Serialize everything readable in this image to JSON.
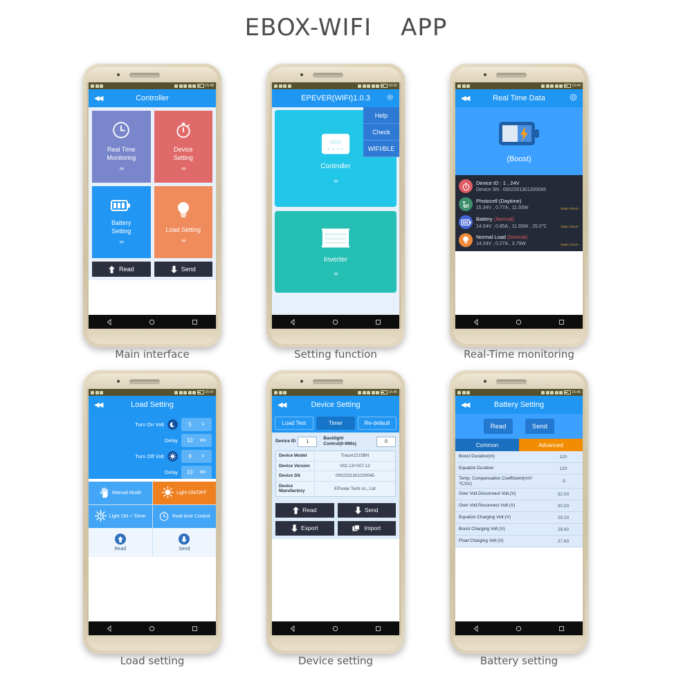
{
  "title": {
    "part1": "EBOX-WIFI",
    "part2": "APP"
  },
  "captions": [
    "Main interface",
    "Setting function",
    "Real-Time monitoring",
    "Load setting",
    "Device setting",
    "Battery setting"
  ],
  "phone1": {
    "status_time": "15:48",
    "header": "Controller",
    "back_icon": "◀◀",
    "tiles": [
      {
        "label1": "Real Time",
        "label2": "Monitoring",
        "chev": "»›",
        "color": "#7986cb",
        "icon": "clock-icon"
      },
      {
        "label1": "Device",
        "label2": "Setting",
        "chev": "»›",
        "color": "#e06a6a",
        "icon": "stopwatch-icon"
      },
      {
        "label1": "Battery",
        "label2": "Setting",
        "chev": "»›",
        "color": "#2196f3",
        "icon": "battery-icon"
      },
      {
        "label1": "Load Setting",
        "label2": "",
        "chev": "»›",
        "color": "#f08b5c",
        "icon": "bulb-icon"
      }
    ],
    "read_label": "Read",
    "send_label": "Send"
  },
  "phone2": {
    "status_time": "15:50",
    "header": "EPEVER(WIFI)1.0.3",
    "menu": [
      "Help",
      "Check",
      "WIFI/BLE"
    ],
    "tile1": {
      "label": "Controller",
      "chev": "»›",
      "color": "#22c6e8"
    },
    "tile2": {
      "label": "Inverter",
      "chev": "»›",
      "color": "#26bfb4"
    }
  },
  "phone3": {
    "status_time": "15:44",
    "header": "Real Time Data",
    "mode": "(Boost)",
    "rows": [
      {
        "title": "Device ID : 1 , 24V",
        "sub": "Device SN : 0002201301200045",
        "color": "#de5b63",
        "icon": "stopwatch-icon",
        "check": "",
        "status": ""
      },
      {
        "title": "Photocell  (Daytime)",
        "sub": "15.34V , 0.77A , 11.93W",
        "color": "#3f8f6d",
        "icon": "solar-panel-icon",
        "check": "State Check ›",
        "status": ""
      },
      {
        "title": "Battery",
        "sub": "14.04V , 0.85A , 11.93W , 25.0℃",
        "color": "#4464d4",
        "icon": "battery-icon",
        "check": "State Check ›",
        "status": "(Normal)"
      },
      {
        "title": "Normal Load",
        "sub": "14.04V , 0.27A , 3.79W",
        "color": "#f08b3c",
        "icon": "bulb-icon",
        "check": "State Check ›",
        "status": "(Normal)"
      }
    ]
  },
  "phone4": {
    "status_time": "15:47",
    "header": "Load Setting",
    "fields": [
      {
        "label": "Turn On Volt",
        "icon": "moon-icon",
        "value": "5",
        "unit": "V"
      },
      {
        "label": "Delay",
        "icon": "",
        "value": "10",
        "unit": "Min"
      },
      {
        "label": "Turn Off Volt",
        "icon": "sun-icon",
        "value": "6",
        "unit": "V"
      },
      {
        "label": "Delay",
        "icon": "",
        "value": "10",
        "unit": "Min"
      }
    ],
    "modes": [
      {
        "label": "Manual Mode",
        "icon": "hand-icon",
        "active": false
      },
      {
        "label": "Light ON/OFF",
        "icon": "sun-icon",
        "active": true
      },
      {
        "label": "Light ON + Timer",
        "icon": "sun-clock-icon",
        "active": false
      },
      {
        "label": "Real-time Control",
        "icon": "clock-icon",
        "active": false
      }
    ],
    "read_label": "Read",
    "send_label": "Send"
  },
  "phone5": {
    "status_time": "15:45",
    "header": "Device Setting",
    "tabs": [
      {
        "label": "Load Test",
        "selected": false
      },
      {
        "label": "Timer",
        "selected": true
      },
      {
        "label": "Re-default",
        "selected": false
      }
    ],
    "device_id_label": "Device ID",
    "device_id_value": "1",
    "backlight_label": "Backlight\nControl(0-999s)",
    "backlight_label_1": "Backlight",
    "backlight_label_2": "Control(0-999s)",
    "backlight_value": "0",
    "table": [
      {
        "key": "Device Model",
        "value": "Tracer2215BN"
      },
      {
        "key": "Device Version",
        "value": "V02.13+V07.12"
      },
      {
        "key": "Device SN",
        "value": "0002201301200045"
      },
      {
        "key": "Device Manufactory",
        "value": "EPsolar Tech co., Ltd"
      }
    ],
    "buttons": [
      {
        "label": "Read",
        "icon": "up-arrow-icon"
      },
      {
        "label": "Send",
        "icon": "down-arrow-icon"
      },
      {
        "label": "Export",
        "icon": "down-arrow-icon"
      },
      {
        "label": "Import",
        "icon": "copy-icon"
      }
    ]
  },
  "phone6": {
    "status_time": "15:46",
    "header": "Battery Setting",
    "read_label": "Read",
    "send_label": "Send",
    "tabs": [
      {
        "label": "Common"
      },
      {
        "label": "Advanced"
      }
    ],
    "table": [
      {
        "key": "Boost Duration(m)",
        "value": "120"
      },
      {
        "key": "Equalize Duration",
        "value": "120"
      },
      {
        "key": "Temp. Compensation Coefficient(mV/℃/2V)",
        "value": "-3"
      },
      {
        "key": "Over Volt.Disconnect Volt.(V)",
        "value": "32.00"
      },
      {
        "key": "Over Volt.Reconnect Volt.(V)",
        "value": "30.00"
      },
      {
        "key": "Equalize Charging Volt.(V)",
        "value": "29.20"
      },
      {
        "key": "Boost Charging Volt.(V)",
        "value": "28.80"
      },
      {
        "key": "Float Charging Volt.(V)",
        "value": "27.60"
      }
    ]
  }
}
